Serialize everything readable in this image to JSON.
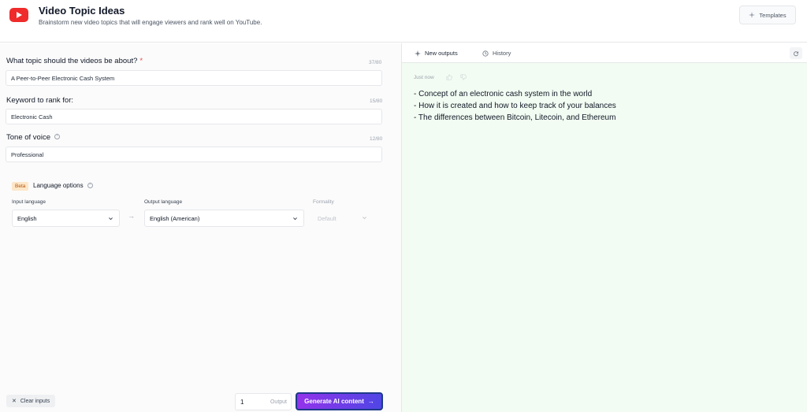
{
  "header": {
    "title": "Video Topic Ideas",
    "subtitle": "Brainstorm new video topics that will engage viewers and rank well on YouTube.",
    "templates_label": "Templates"
  },
  "form": {
    "topic": {
      "label": "What topic should the videos be about?",
      "required_mark": "*",
      "count": "37/80",
      "value": "A Peer-to-Peer Electronic Cash System"
    },
    "keyword": {
      "label": "Keyword to rank for:",
      "count": "15/80",
      "value": "Electronic Cash"
    },
    "tone": {
      "label": "Tone of voice",
      "count": "12/80",
      "value": "Professional"
    }
  },
  "language": {
    "beta": "Beta",
    "title": "Language options",
    "input_label": "Input language",
    "input_value": "English",
    "output_label": "Output language",
    "output_value": "English (American)",
    "formality_label": "Formality",
    "formality_value": "Default",
    "arrow": "→"
  },
  "footer": {
    "clear_label": "Clear inputs",
    "output_count": "1",
    "output_label": "Output",
    "generate_label": "Generate AI content"
  },
  "results": {
    "tabs": [
      "New outputs",
      "History"
    ],
    "timestamp": "Just now",
    "lines": [
      "- Concept of an electronic cash system in the world",
      "- How it is created and how to keep track of your balances",
      "- The differences between Bitcoin, Litecoin, and Ethereum"
    ]
  },
  "colors": {
    "brand_red": "#ef2b2b",
    "generate_gradient_start": "#9333ea",
    "generate_gradient_end": "#4f46e5",
    "output_bg": "#f2fcf2"
  }
}
